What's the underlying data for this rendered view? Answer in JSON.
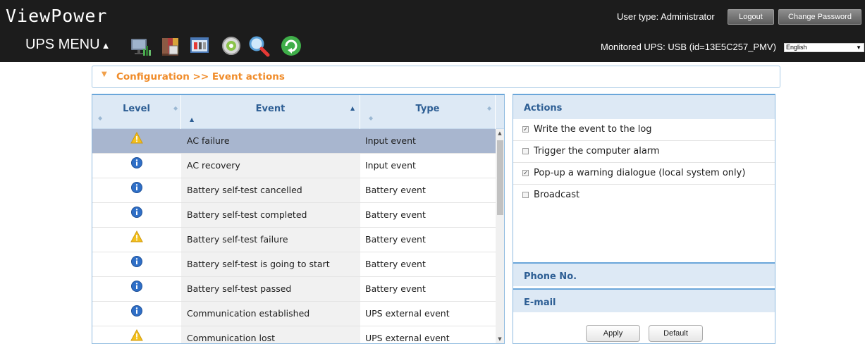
{
  "header": {
    "app_title": "ViewPower",
    "ups_menu_label": "UPS MENU",
    "user_type": "User type: Administrator",
    "logout_label": "Logout",
    "change_password_label": "Change Password",
    "monitored_ups": "Monitored UPS: USB (id=13E5C257_PMV)",
    "language_selected": "English",
    "toolbar_icons": [
      "monitor-icon",
      "records-icon",
      "control-icon",
      "configuration-icon",
      "search-icon",
      "refresh-icon"
    ]
  },
  "breadcrumb": "Configuration >> Event actions",
  "table": {
    "columns": [
      "Level",
      "Event",
      "Type"
    ],
    "rows": [
      {
        "level": "warning",
        "event": "AC failure",
        "type": "Input event"
      },
      {
        "level": "info",
        "event": "AC recovery",
        "type": "Input event"
      },
      {
        "level": "info",
        "event": "Battery self-test cancelled",
        "type": "Battery event"
      },
      {
        "level": "info",
        "event": "Battery self-test completed",
        "type": "Battery event"
      },
      {
        "level": "warning",
        "event": "Battery self-test failure",
        "type": "Battery event"
      },
      {
        "level": "info",
        "event": "Battery self-test is going to start",
        "type": "Battery event"
      },
      {
        "level": "info",
        "event": "Battery self-test passed",
        "type": "Battery event"
      },
      {
        "level": "info",
        "event": "Communication established",
        "type": "UPS external event"
      },
      {
        "level": "warning",
        "event": "Communication lost",
        "type": "UPS external event"
      }
    ]
  },
  "actions": {
    "title": "Actions",
    "items": [
      {
        "label": "Write the event to the log",
        "checked": true
      },
      {
        "label": "Trigger the computer alarm",
        "checked": false
      },
      {
        "label": "Pop-up a warning dialogue (local system only)",
        "checked": true
      },
      {
        "label": "Broadcast",
        "checked": false
      }
    ]
  },
  "phone_title": "Phone No.",
  "email_title": "E-mail",
  "apply_label": "Apply",
  "default_label": "Default",
  "colors": {
    "header_bg": "#1c1c1c",
    "accent_orange": "#f08c2a",
    "table_header_bg": "#dde9f5",
    "selected_row": "#a8b6cf",
    "warning": "#f3c01b",
    "info": "#2f6fc7"
  }
}
